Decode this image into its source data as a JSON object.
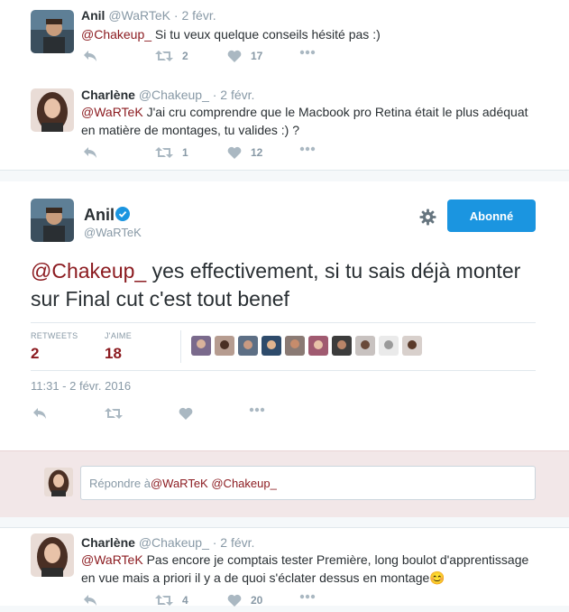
{
  "tweet1": {
    "name": "Anil",
    "handle": "@WaRTeK",
    "date": "· 2 févr.",
    "mention": "@Chakeup_",
    "text": " Si tu veux quelque conseils hésité pas :)",
    "retweets": "2",
    "likes": "17"
  },
  "tweet2": {
    "name": "Charlène",
    "handle": "@Chakeup_",
    "date": "· 2 févr.",
    "mention": "@WaRTeK",
    "text_line1": " J'ai cru comprendre que le Macbook pro Retina était le plus adéquat",
    "text_line2": "en matière de montages, tu valides :) ?",
    "retweets": "1",
    "likes": "12"
  },
  "main": {
    "name": "Anil",
    "handle": "@WaRTeK",
    "follow_label": "Abonné",
    "mention": "@Chakeup_",
    "text": " yes effectivement, si tu sais déjà monter sur Final cut c'est tout benef",
    "retweets_label": "RETWEETS",
    "retweets": "2",
    "likes_label": "J'AIME",
    "likes": "18",
    "timestamp": "11:31 - 2 févr. 2016"
  },
  "reply_box": {
    "prefix": "Répondre à ",
    "mention1": "@WaRTeK",
    "mention2": "@Chakeup_"
  },
  "tweet3": {
    "name": "Charlène",
    "handle": "@Chakeup_",
    "date": "· 2 févr.",
    "mention": "@WaRTeK",
    "text_line1": " Pas encore je comptais tester Première, long boulot d'apprentissage",
    "text_line2": "en vue mais a priori il y a de quoi s'éclater dessus en montage",
    "emoji": "😊",
    "retweets": "4",
    "likes": "20"
  },
  "colors": {
    "mention": "#8b1a1f",
    "follow_button": "#1b95e0",
    "reply_bg": "#f2e7e8"
  }
}
